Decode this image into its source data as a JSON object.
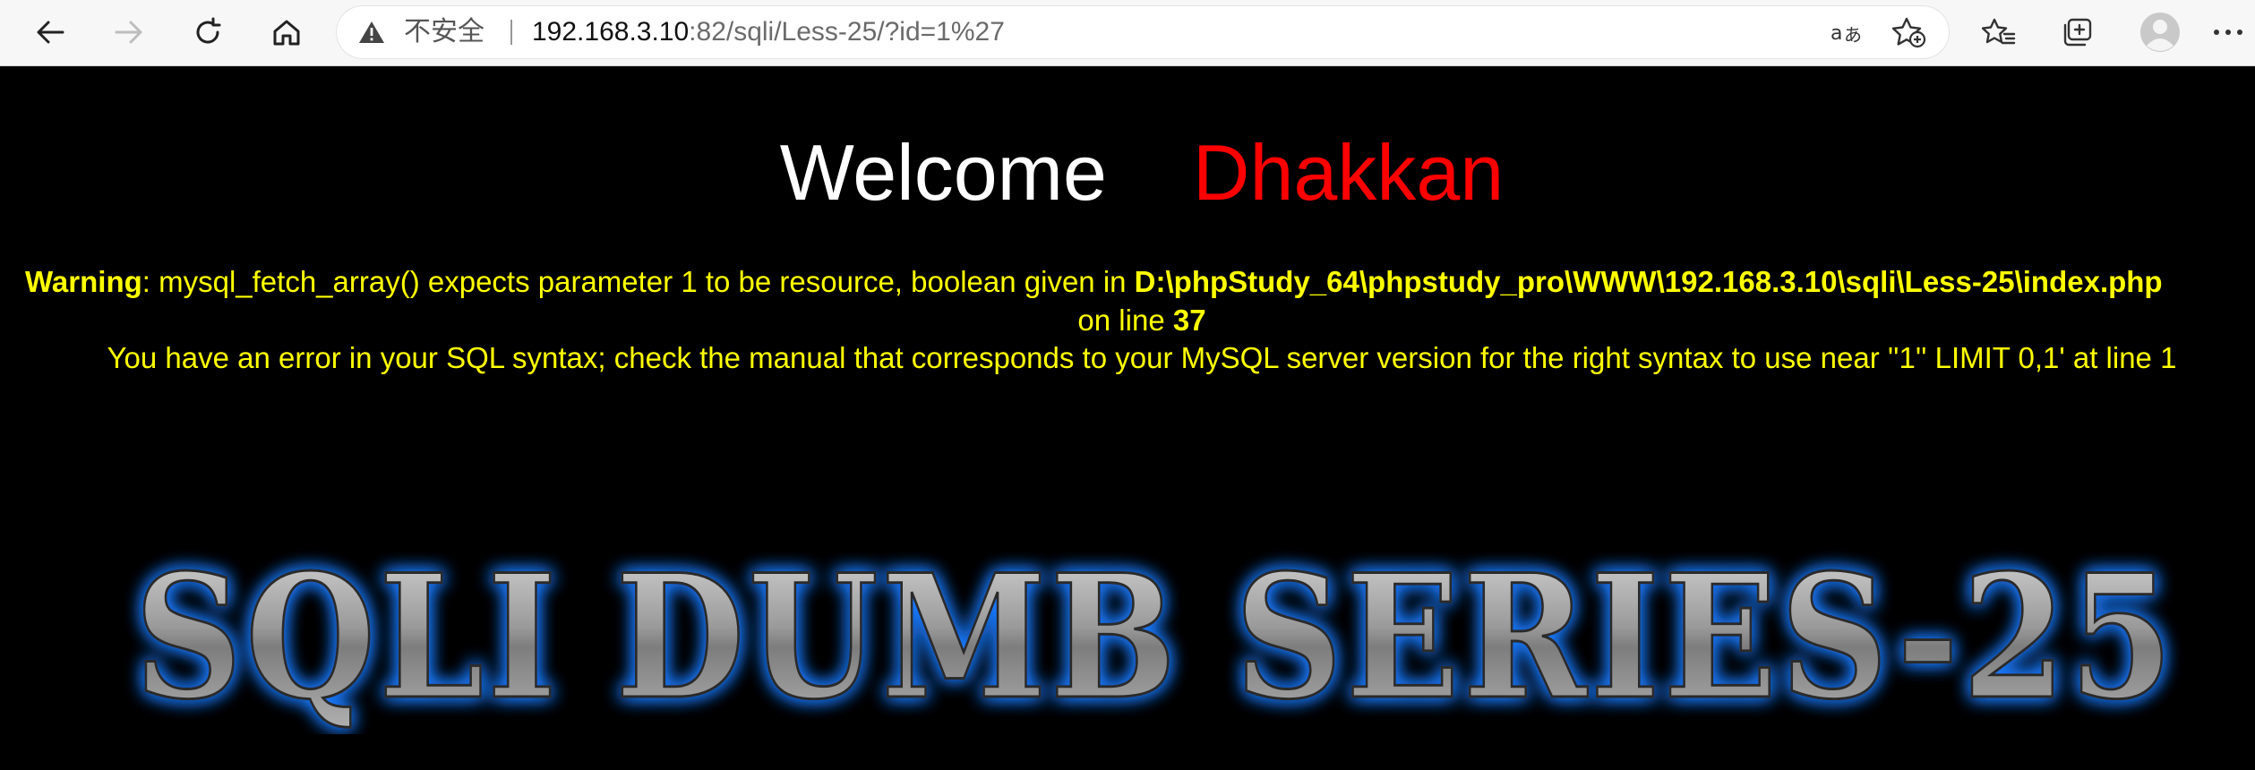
{
  "browser": {
    "back_icon": "arrow-left-icon",
    "forward_icon": "arrow-right-icon",
    "refresh_icon": "refresh-icon",
    "home_icon": "home-icon",
    "security_status": "不安全",
    "url_host": "192.168.3.10",
    "url_path": ":82/sqli/Less-25/?id=1%27",
    "read_aloud_icon": "read-aloud-icon",
    "add_favorite_icon": "star-add-icon",
    "favorites_icon": "favorites-icon",
    "collections_icon": "collections-icon",
    "profile_icon": "avatar-icon",
    "more_icon": "more-icon"
  },
  "page": {
    "welcome_text": "Welcome",
    "welcome_name": "Dhakkan",
    "warning_label": "Warning",
    "warning_message": ": mysql_fetch_array() expects parameter 1 to be resource, boolean given in ",
    "warning_path": "D:\\phpStudy_64\\phpstudy_pro\\WWW\\192.168.3.10\\sqli\\Less-25\\index.php",
    "on_line_text": "on line ",
    "line_number": "37",
    "sql_error": "You have an error in your SQL syntax; check the manual that corresponds to your MySQL server version for the right syntax to use near ''1'' LIMIT 0,1' at line 1",
    "banner_text": "SQLI DUMB SERIES-25"
  },
  "colors": {
    "background": "#000000",
    "welcome": "#ffffff",
    "name": "#ff0000",
    "error_text": "#ffff00",
    "banner_glow": "#1e7bff",
    "banner_fill": "#9a9a9a"
  }
}
